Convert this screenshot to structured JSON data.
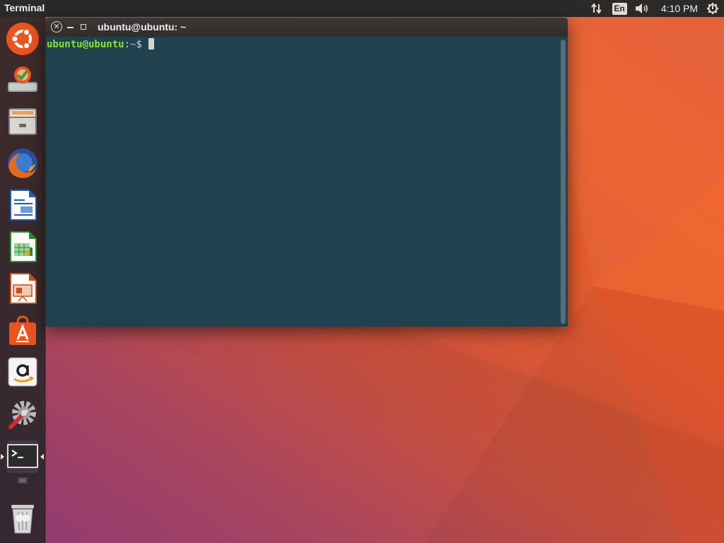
{
  "top_panel": {
    "app_title": "Terminal",
    "network_icon": "network-updown-icon",
    "keyboard_layout": "En",
    "volume_icon": "volume-icon",
    "clock": "4:10 PM",
    "power_icon": "power-gear-icon"
  },
  "launcher": {
    "items": [
      {
        "name": "ubuntu-dash",
        "icon": "ubuntu-logo-icon"
      },
      {
        "name": "software-updater",
        "icon": "software-updater-icon"
      },
      {
        "name": "files",
        "icon": "file-cabinet-icon"
      },
      {
        "name": "firefox",
        "icon": "firefox-icon"
      },
      {
        "name": "libreoffice-writer",
        "icon": "writer-document-icon"
      },
      {
        "name": "libreoffice-calc",
        "icon": "calc-spreadsheet-icon"
      },
      {
        "name": "libreoffice-impress",
        "icon": "impress-presentation-icon"
      },
      {
        "name": "ubuntu-software",
        "icon": "shopping-bag-icon"
      },
      {
        "name": "amazon",
        "icon": "amazon-icon"
      },
      {
        "name": "system-settings",
        "icon": "settings-wrench-icon"
      },
      {
        "name": "terminal",
        "icon": "terminal-icon"
      },
      {
        "name": "workspace-switcher",
        "icon": "workspace-icon"
      },
      {
        "name": "trash",
        "icon": "trash-icon"
      }
    ]
  },
  "window": {
    "title": "ubuntu@ubuntu: ~",
    "close_glyph": "✕"
  },
  "terminal": {
    "user_host": "ubuntu@ubuntu",
    "separator": ":",
    "path": "~",
    "dollar": "$"
  },
  "colors": {
    "terminal_bg": "#20424f",
    "prompt_user": "#8ae234",
    "prompt_path": "#729fcf",
    "panel_bg": "#2b2a28"
  }
}
